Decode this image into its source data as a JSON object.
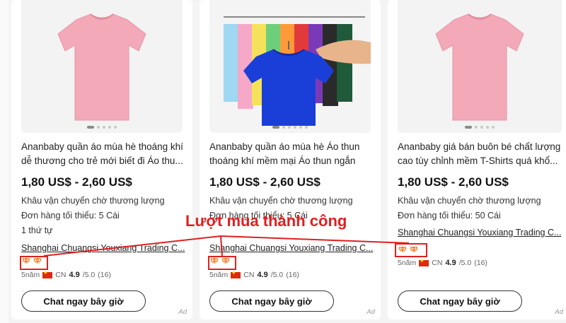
{
  "products": [
    {
      "title": "Ananbaby quần áo mùa hè thoáng khí dễ thương cho trẻ mới biết đi Áo thu...",
      "price": "1,80 US$ - 2,60 US$",
      "shipping": "Khâu vận chuyển chờ thương lượng",
      "moq": "Đơn hàng tối thiểu: 5 Cái",
      "order_rank": "1 thứ tự",
      "supplier": "Shanghai Chuangsi Youxiang Trading C...",
      "years": "5năm",
      "country": "CN",
      "rating": "4.9",
      "rating_max": "/5.0",
      "reviews": "(16)",
      "chat_label": "Chat ngay bây giờ",
      "ad_label": "Ad",
      "image": "pink-tshirt"
    },
    {
      "title": "Ananbaby quần áo mùa hè Áo thun thoáng khí mềm mại Áo thun ngắn ta...",
      "price": "1,80 US$ - 2,60 US$",
      "shipping": "Khâu vận chuyển chờ thương lượng",
      "moq": "Đơn hàng tối thiểu: 5 Cái",
      "supplier": "Shanghai Chuangsi Youxiang Trading C...",
      "years": "5năm",
      "country": "CN",
      "rating": "4.9",
      "rating_max": "/5.0",
      "reviews": "(16)",
      "chat_label": "Chat ngay bây giờ",
      "ad_label": "Ad",
      "image": "colorful-tshirts-on-hangers"
    },
    {
      "title": "Ananbaby giá bán buôn bé chất lượng cao tùy chỉnh mềm T-Shirts quá khổ...",
      "price": "1,80 US$ - 2,60 US$",
      "shipping": "Khâu vận chuyển chờ thương lượng",
      "moq": "Đơn hàng tối thiểu: 50 Cái",
      "supplier": "Shanghai Chuangsi Youxiang Trading C...",
      "years": "5năm",
      "country": "CN",
      "rating": "4.9",
      "rating_max": "/5.0",
      "reviews": "(16)",
      "chat_label": "Chat ngay bây giờ",
      "ad_label": "Ad",
      "image": "pink-tshirt"
    }
  ],
  "annotation": {
    "label": "Lượt mua thành công",
    "color": "#e02020"
  },
  "colors": {
    "badge": "#f07a20",
    "flag": "#de2910",
    "tshirt_pink": "#f3a9b8"
  }
}
